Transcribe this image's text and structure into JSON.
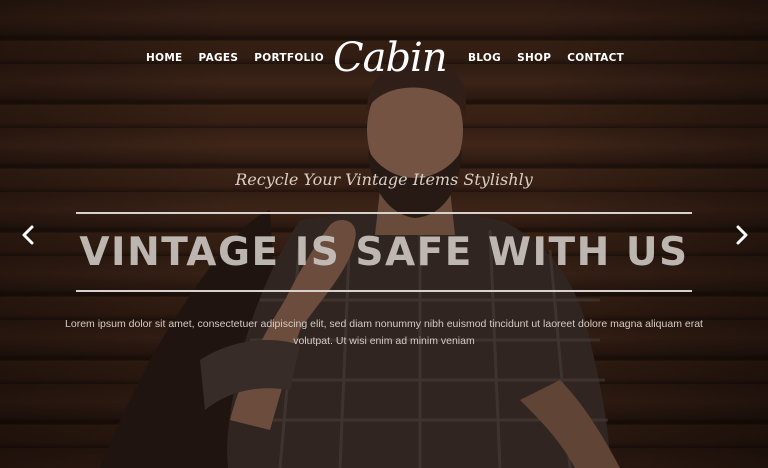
{
  "nav": {
    "left_items": [
      "HOME",
      "PAGES",
      "PORTFOLIO"
    ],
    "right_items": [
      "BLOG",
      "SHOP",
      "CONTACT"
    ],
    "logo_text": "Cabin"
  },
  "hero": {
    "tagline": "Recycle Your Vintage Items Stylishly",
    "headline": "VINTAGE IS SAFE WITH US",
    "body": "Lorem ipsum dolor sit amet, consectetuer adipiscing elit, sed diam nonummy nibh euismod tincidunt ut laoreet dolore magna aliquam erat volutpat. Ut wisi enim ad minim veniam"
  },
  "slider": {
    "prev_icon": "chevron-left-icon",
    "next_icon": "chevron-right-icon"
  },
  "colors": {
    "text_white": "#ffffff",
    "rule": "#d8d2cc"
  }
}
